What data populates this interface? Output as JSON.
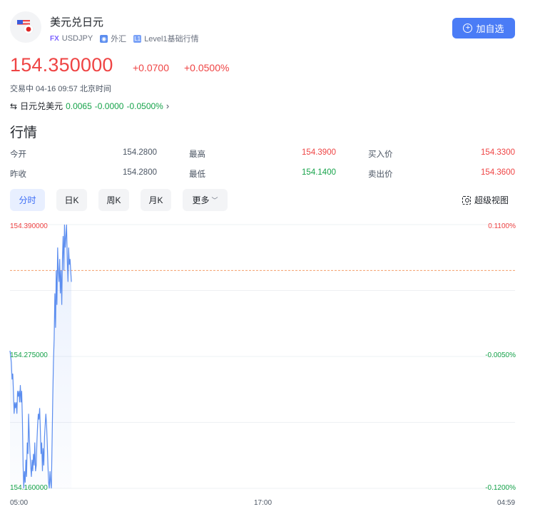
{
  "header": {
    "title": "美元兑日元",
    "fx_tag": "FX",
    "symbol": "USDJPY",
    "market": "外汇",
    "level": "Level1基础行情",
    "add_button": "加自选"
  },
  "quote": {
    "price": "154.350000",
    "change": "+0.0700",
    "change_pct": "+0.0500%",
    "status": "交易中 04-16 09:57 北京时间",
    "reverse_label": "日元兑美元",
    "reverse_price": "0.0065",
    "reverse_change": "-0.0000",
    "reverse_pct": "-0.0500%"
  },
  "market_section": {
    "title": "行情",
    "rows": [
      {
        "l1": "今开",
        "v1": "154.2800",
        "l2": "最高",
        "v2": "154.3900",
        "l3": "买入价",
        "v3": "154.3300"
      },
      {
        "l1": "昨收",
        "v1": "154.2800",
        "l2": "最低",
        "v2": "154.1400",
        "l3": "卖出价",
        "v3": "154.3600"
      }
    ]
  },
  "tabs": [
    "分时",
    "日K",
    "周K",
    "月K",
    "更多"
  ],
  "super_view": "超级视图",
  "colors": {
    "up": "#ef4444",
    "down": "#16a34a",
    "line": "#5b8def",
    "accent": "#4a7cf6"
  },
  "chart_data": {
    "type": "line",
    "y_left_labels": [
      "154.390000",
      "154.275000",
      "154.160000"
    ],
    "y_right_labels": [
      "0.1100%",
      "-0.0050%",
      "-0.1200%"
    ],
    "x_labels": [
      "05:00",
      "17:00",
      "04:59"
    ],
    "ylim": [
      154.16,
      154.39
    ],
    "prev_close": 154.35,
    "series": [
      {
        "values": [
          154.28,
          154.275,
          154.27,
          154.255,
          154.26,
          154.245,
          154.225,
          154.235,
          154.23,
          154.235,
          154.225,
          154.245,
          154.24,
          154.245,
          154.235,
          154.25,
          154.235,
          154.245,
          154.22,
          154.18,
          154.16,
          154.175,
          154.165,
          154.185,
          154.17,
          154.2,
          154.19,
          154.225,
          154.205,
          154.19,
          154.18,
          154.17,
          154.185,
          154.175,
          154.19,
          154.18,
          154.2,
          154.175,
          154.18,
          154.2,
          154.215,
          154.225,
          154.22,
          154.23,
          154.21,
          154.19,
          154.2,
          154.175,
          154.195,
          154.18,
          154.205,
          154.215,
          154.225,
          154.215,
          154.2,
          154.18,
          154.165,
          154.16,
          154.175,
          154.165,
          154.16,
          154.2,
          154.24,
          154.27,
          154.29,
          154.33,
          154.3,
          154.35,
          154.32,
          154.37,
          154.35,
          154.34,
          154.36,
          154.33,
          154.35,
          154.32,
          154.36,
          154.38,
          154.35,
          154.39,
          154.37,
          154.38,
          154.39,
          154.36,
          154.34,
          154.37,
          154.355,
          154.36,
          154.35,
          154.34
        ]
      }
    ]
  }
}
